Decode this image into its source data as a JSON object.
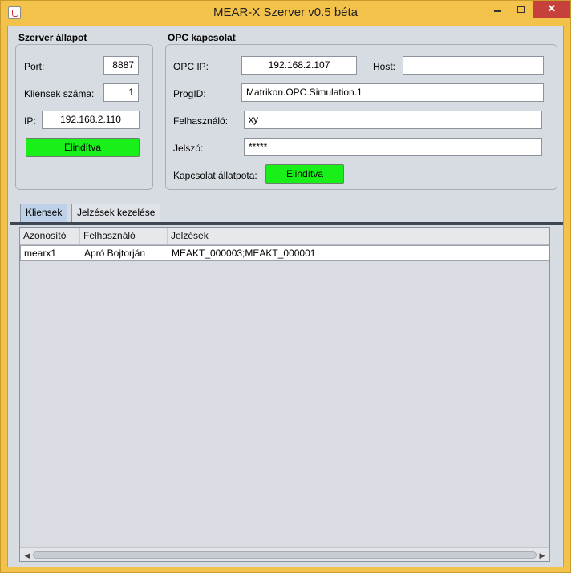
{
  "window": {
    "title": "MEAR-X Szerver v0.5 béta",
    "close_label": "✕"
  },
  "server_status": {
    "title": "Szerver állapot",
    "port_label": "Port:",
    "port_value": "8887",
    "clients_label": "Kliensek száma:",
    "clients_value": "1",
    "ip_label": "IP:",
    "ip_value": "192.168.2.110",
    "status_button": "Elindítva"
  },
  "opc": {
    "title": "OPC kapcsolat",
    "ip_label": "OPC IP:",
    "ip_value": "192.168.2.107",
    "host_label": "Host:",
    "host_value": "",
    "progid_label": "ProgID:",
    "progid_value": "Matrikon.OPC.Simulation.1",
    "user_label": "Felhasználó:",
    "user_value": "xy",
    "password_label": "Jelszó:",
    "password_value": "*****",
    "conn_status_label": "Kapcsolat állatpota:",
    "conn_status_button": "Elindítva"
  },
  "tabs": [
    {
      "label": "Kliensek",
      "active": true
    },
    {
      "label": "Jelzések kezelése",
      "active": false
    }
  ],
  "table": {
    "columns": [
      "Azonosító",
      "Felhasználó",
      "Jelzések"
    ],
    "rows": [
      [
        "mearx1",
        "Apró Bojtorján",
        "MEAKT_000003;MEAKT_000001"
      ]
    ]
  },
  "scrollbar": {
    "left_arrow": "◀",
    "right_arrow": "▶"
  },
  "colors": {
    "status_green": "#19ef19",
    "titlebar": "#f3c24a",
    "close_red": "#c7413c"
  }
}
